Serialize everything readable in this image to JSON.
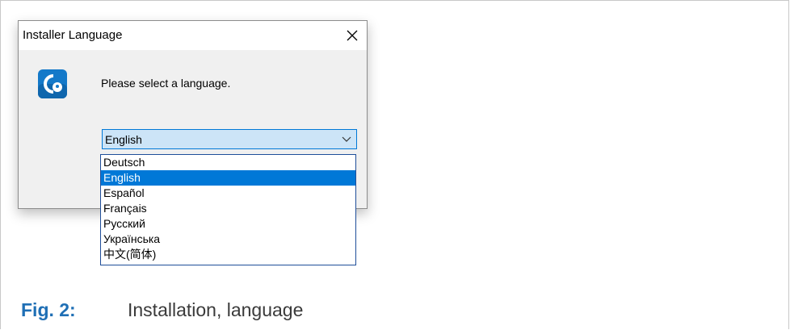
{
  "dialog": {
    "title": "Installer Language",
    "prompt": "Please select a language.",
    "icon": "app-logo-icon",
    "close_icon": "close-icon"
  },
  "language_select": {
    "selected_value": "English",
    "options": [
      {
        "label": "Deutsch",
        "selected": false
      },
      {
        "label": "English",
        "selected": true
      },
      {
        "label": "Español",
        "selected": false
      },
      {
        "label": "Français",
        "selected": false
      },
      {
        "label": "Русский",
        "selected": false
      },
      {
        "label": "Українська",
        "selected": false
      },
      {
        "label": "中文(简体)",
        "selected": false
      }
    ]
  },
  "caption": {
    "label": "Fig. 2:",
    "text": "Installation, language"
  },
  "colors": {
    "accent": "#0078d7",
    "caption_label": "#1f6fb5",
    "icon_bg": "#1479c9"
  }
}
